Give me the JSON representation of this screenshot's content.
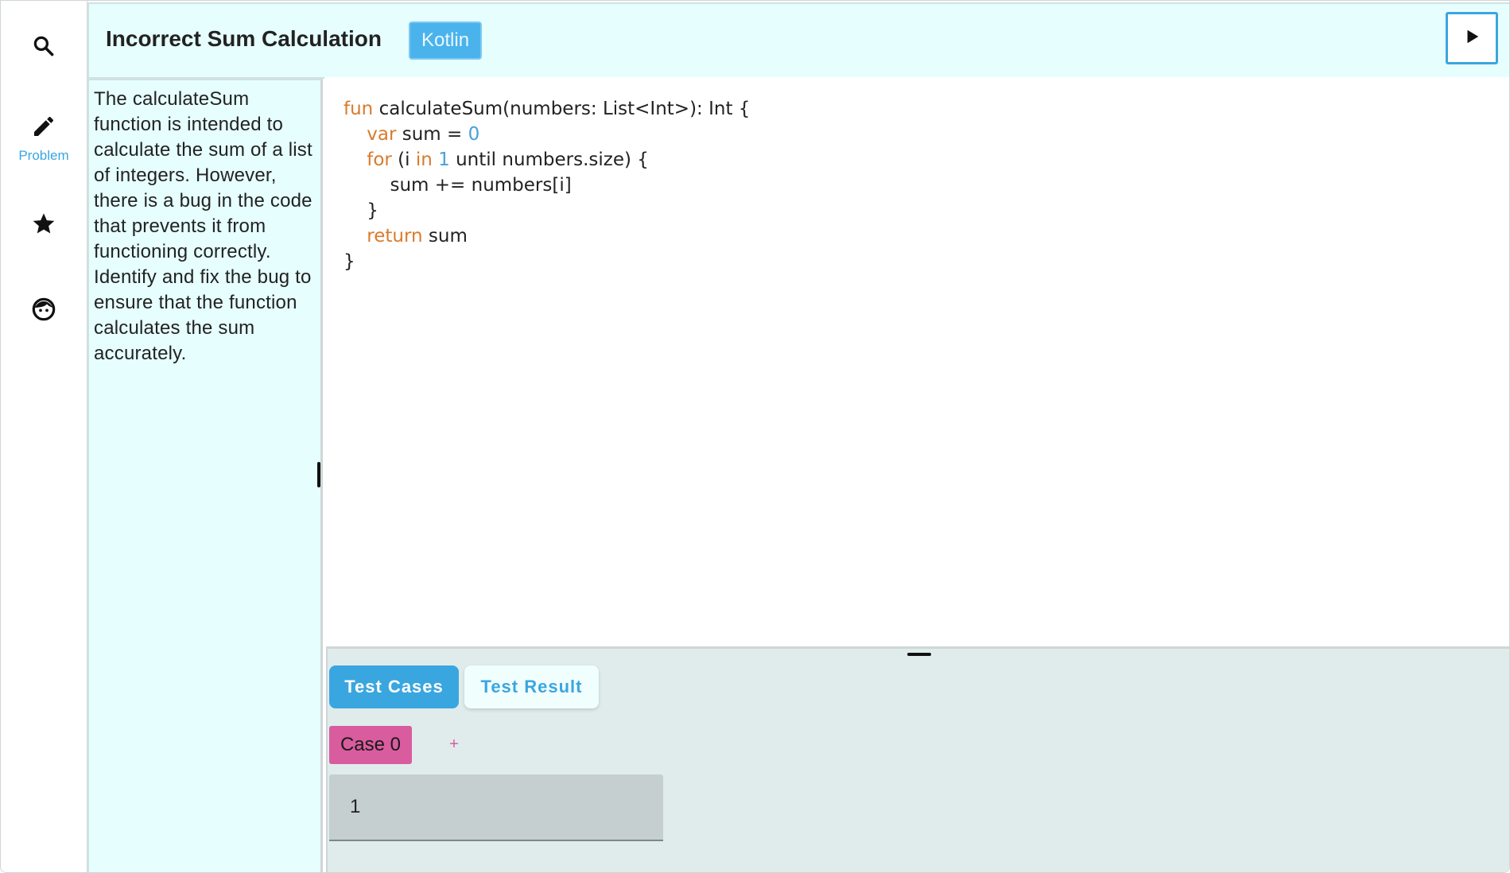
{
  "nav": {
    "items": [
      {
        "icon": "search-icon",
        "label": ""
      },
      {
        "icon": "pencil-icon",
        "label": "Problem"
      },
      {
        "icon": "star-icon",
        "label": ""
      },
      {
        "icon": "face-icon",
        "label": ""
      }
    ]
  },
  "header": {
    "title": "Incorrect Sum Calculation",
    "language": "Kotlin",
    "run_icon": "play-icon"
  },
  "problem": {
    "description": "The calculateSum function is intended to calculate the sum of a list of integers. However, there is a bug in the code that prevents it from functioning correctly. Identify and fix the bug to ensure that the function calculates the sum accurately."
  },
  "editor": {
    "code_lines": [
      "fun calculateSum(numbers: List<Int>): Int {",
      "    var sum = 0",
      "    for (i in 1 until numbers.size) {",
      "        sum += numbers[i]",
      "    }",
      "    return sum",
      "}"
    ]
  },
  "bottom": {
    "tabs": [
      {
        "label": "Test Cases",
        "active": true
      },
      {
        "label": "Test Result",
        "active": false
      }
    ],
    "cases": [
      {
        "label": "Case 0"
      }
    ],
    "add_case_label": "+",
    "case_input_value": "1"
  },
  "colors": {
    "accent": "#3aa6e0",
    "panel_bg": "#e6fefe",
    "case_chip": "#d95c9e",
    "keyword": "#d97b2b",
    "number": "#4aa0d8"
  }
}
